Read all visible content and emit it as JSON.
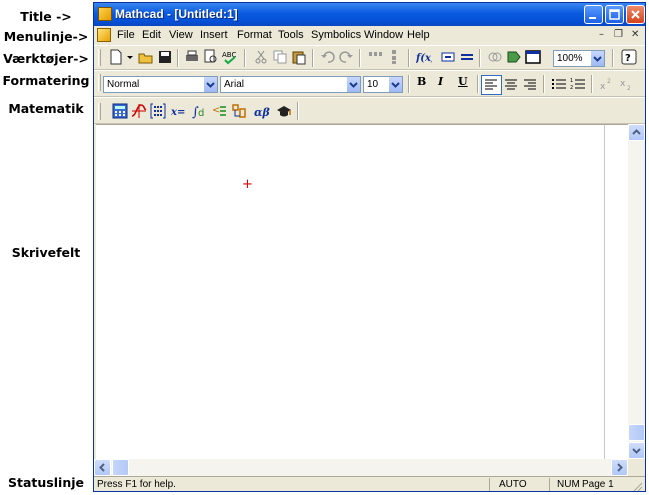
{
  "annotations": {
    "title": "Title ->",
    "menu": "Menulinje->",
    "tools": "Værktøjer->",
    "format": "Formatering",
    "math": "Matematik",
    "workspace": "Skrivefelt",
    "status": "Statuslinje"
  },
  "window": {
    "title": "Mathcad - [Untitled:1]"
  },
  "menu": {
    "items": [
      "File",
      "Edit",
      "View",
      "Insert",
      "Format",
      "Tools",
      "Symbolics",
      "Window",
      "Help"
    ]
  },
  "toolbar": {
    "zoom_value": "100%"
  },
  "formatting": {
    "style_value": "Normal",
    "font_value": "Arial",
    "size_value": "10",
    "bold": "B",
    "italic": "I",
    "underline": "U"
  },
  "math_toolbar": {
    "evaluation_label": "x=",
    "greek_label": "αβ"
  },
  "statusbar": {
    "help_text": "Press F1 for help.",
    "mode": "AUTO",
    "num": "NUM",
    "page": "Page 1"
  }
}
